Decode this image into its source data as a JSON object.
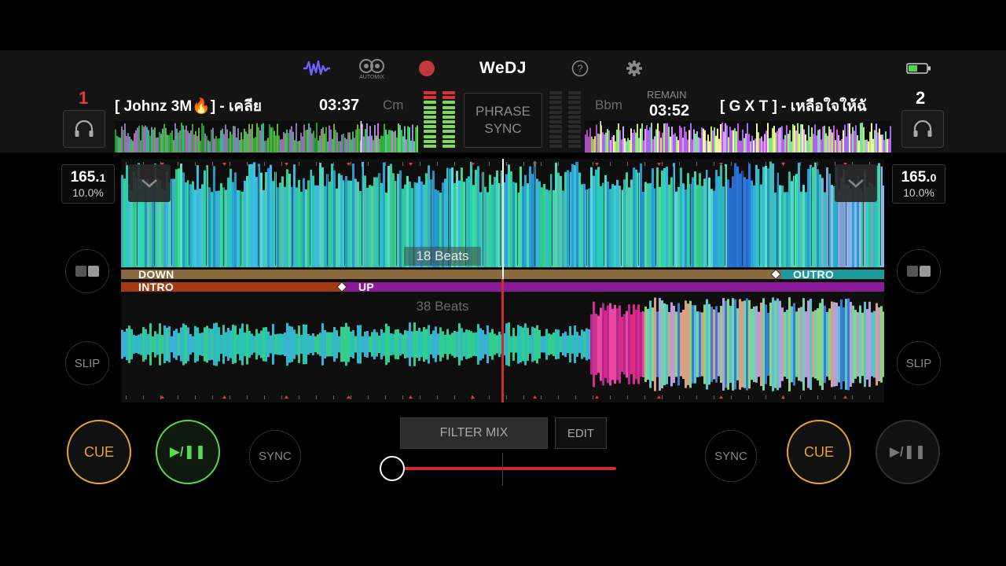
{
  "app": {
    "name": "WeDJ",
    "automix_label": "AUTOMIX"
  },
  "colors": {
    "accent_cue": "#e8a330",
    "accent_play": "#5bd651",
    "record": "#c0393f",
    "crossfader": "#d12a2a",
    "battery": "#46d94b"
  },
  "icons": [
    "waveform-icon",
    "automix-icon",
    "record-icon",
    "help-icon",
    "gear-icon",
    "battery-icon",
    "headphones-icon",
    "chevron-down-icon",
    "slip-icon",
    "pad-icon"
  ],
  "deck1": {
    "number": "1",
    "title": "[ Johnz 3M🔥] - เคลีย",
    "time": "03:37",
    "key": "Cm",
    "bpm": "165.1",
    "bpm_int": "165.",
    "bpm_dec": "1",
    "pitch": "10.0%",
    "cue_label": "CUE",
    "play_label": "▶/❚❚",
    "sync_label": "SYNC",
    "slip_label": "SLIP",
    "beats_label": "18 Beats",
    "phrases": {
      "top": "DOWN",
      "bottom": "INTRO",
      "up": "UP"
    }
  },
  "deck2": {
    "number": "2",
    "title": "[ G X T ] - เหลือใจให้ฉั",
    "remain_label": "REMAIN",
    "time": "03:52",
    "key": "Bbm",
    "bpm": "165.0",
    "bpm_int": "165.",
    "bpm_dec": "0",
    "pitch": "10.0%",
    "cue_label": "CUE",
    "play_label": "▶/❚❚",
    "sync_label": "SYNC",
    "slip_label": "SLIP",
    "beats_label": "38 Beats",
    "phrases": {
      "outro": "OUTRO"
    }
  },
  "center": {
    "phrase_sync_line1": "PHRASE",
    "phrase_sync_line2": "SYNC",
    "filter_mix": "FILTER MIX",
    "edit": "EDIT",
    "crossfader_position": 0
  }
}
